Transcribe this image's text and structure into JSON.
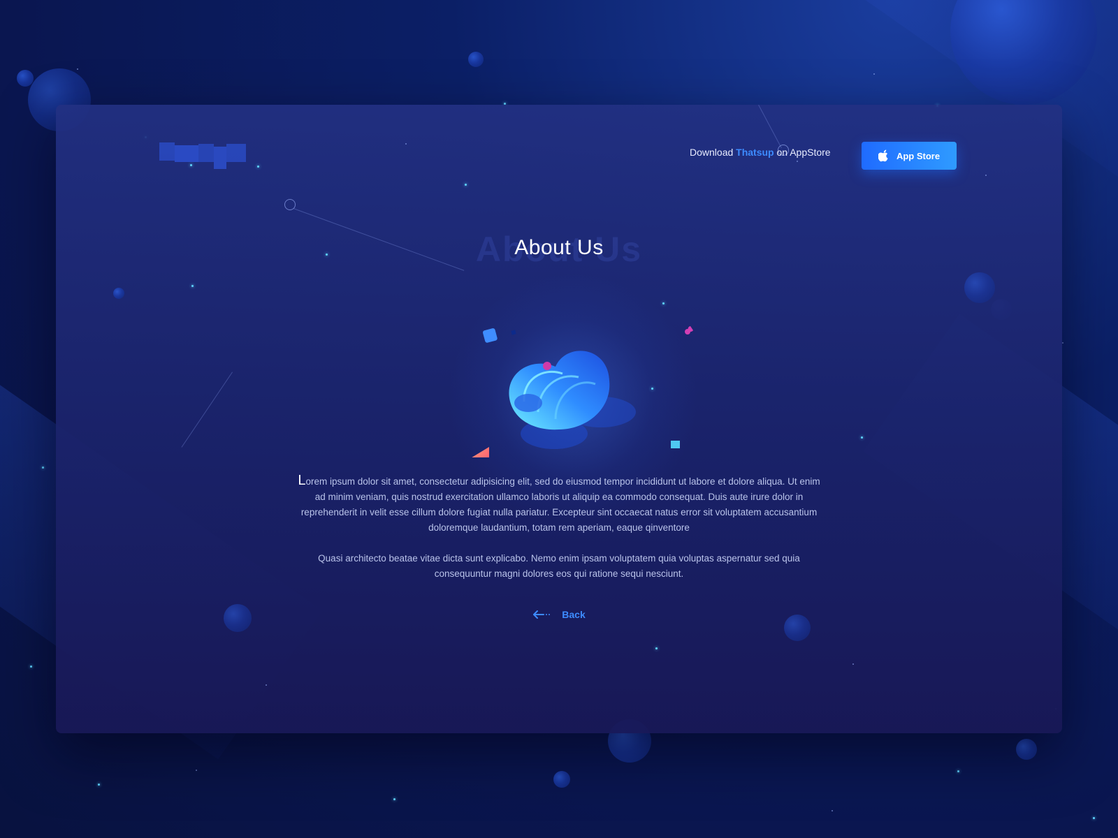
{
  "header": {
    "logo_alt": "",
    "download_prefix": "Download",
    "download_brand": "Thatsup",
    "download_suffix": "on AppStore",
    "appstore_button_label": "App Store",
    "appstore_icon": "apple-icon"
  },
  "main": {
    "title_shadow": "About Us",
    "title": "About Us",
    "paragraph_1_dropcap": "L",
    "paragraph_1_rest": "orem ipsum dolor sit amet, consectetur adipisicing elit, sed do eiusmod tempor incididunt ut labore et dolore aliqua. Ut enim ad minim veniam, quis nostrud exercitation ullamco laboris ut aliquip ea commodo consequat. Duis aute irure dolor in reprehenderit in velit esse cillum dolore fugiat nulla pariatur. Excepteur sint occaecat natus error sit voluptatem accusantium doloremque laudantium, totam rem aperiam, eaque qinventore",
    "paragraph_2": "Quasi architecto beatae vitae dicta sunt explicabo. Nemo enim ipsam voluptatem quia voluptas aspernatur sed quia consequuntur magni dolores eos qui ratione sequi nesciunt.",
    "back_label": "Back",
    "back_icon": "arrow-left-icon"
  },
  "colors": {
    "accent": "#3d8bff",
    "button_start": "#1f6bff",
    "button_end": "#2f9bff",
    "background": "#0a1650",
    "panel": "#1e2a7a",
    "body_text": "#b9c3ea"
  }
}
